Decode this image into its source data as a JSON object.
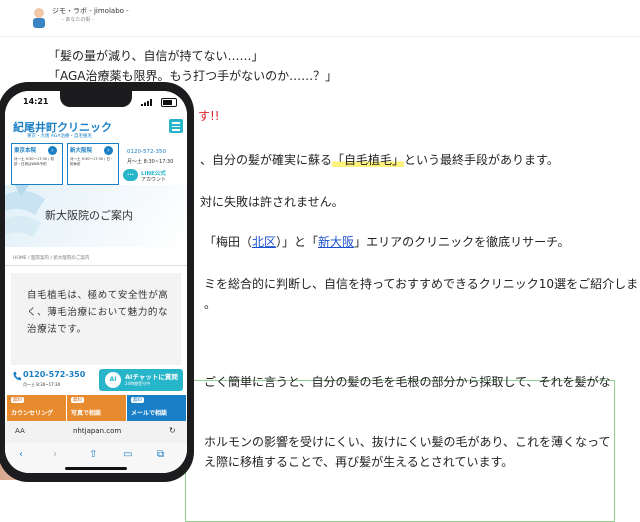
{
  "site": {
    "name": "ジモ・ラボ - jimolabo -",
    "tagline": "- あなたの街 -"
  },
  "article": {
    "quote1": "「髪の量が減り、自信が持てない……」",
    "quote2": "「AGA治療薬も限界。もう打つ手がないのか……？」",
    "emph_tail": "す!!",
    "p2_prefix": "、自分の髪が確実に蘇る",
    "p2_highlight": "「自毛植毛」",
    "p2_suffix": "という最終手段があります。",
    "p3": "対に失敗は許されません。",
    "p4_a": "「梅田（",
    "p4_link1": "北区",
    "p4_b": "）」と「",
    "p4_link2": "新大阪",
    "p4_c": "」エリアのクリニックを徹底リサーチ。",
    "p5a": "ミを総合的に判断し、自信を持っておすすめできるクリニック10選をご紹介しま",
    "p5b": "。",
    "box_line1": "ごく簡単に言うと、自分の髪の毛を毛根の部分から採取して、それを髪がな",
    "box_line2": "ホルモンの影響を受けにくい、抜けにくい髪の毛があり、これを薄くなって",
    "box_line3": "え際に移植することで、再び髪が生えるとされています。"
  },
  "phone": {
    "time": "14:21",
    "clinic": {
      "logo": "紀尾井町クリニック",
      "sub": "東京・大阪 AGA治療・自毛植毛",
      "branch1_title": "東京本院",
      "branch1_hours": "月〜土 9:30〜17:30 / 初診・日祝はWEB予約",
      "branch2_title": "新大阪院",
      "branch2_hours": "月〜土 9:30〜17:30 / 日・祝休診",
      "tel": "0120-572-350",
      "tel_hours": "月〜土 8:30~17:30",
      "line_label": "LINE公式",
      "line_sub": "アカウント"
    },
    "hero_title": "新大阪院のご案内",
    "breadcrumb": "HOME / 医院案内 / 新大阪院のご案内",
    "intro": "自毛植毛は、極めて安全性が高く、薄毛治療において魅力的な治療法です。",
    "cta": {
      "tel": "0120-572-350",
      "tel_hours": "月〜土 8:30~17:30",
      "ai_icon": "AI",
      "ai_label": "AIチャットに質問",
      "ai_sub": "24時間受付中",
      "free": "無料",
      "counseling": "カウンセリング",
      "photo": "写真で相談",
      "mail": "メールで相談"
    },
    "url": "nhtjapan.com",
    "aa": "AA"
  },
  "colors": {
    "accent": "#1a7fc5",
    "teal": "#27b5c9",
    "orange": "#e88b2e",
    "red": "#e0262b"
  }
}
